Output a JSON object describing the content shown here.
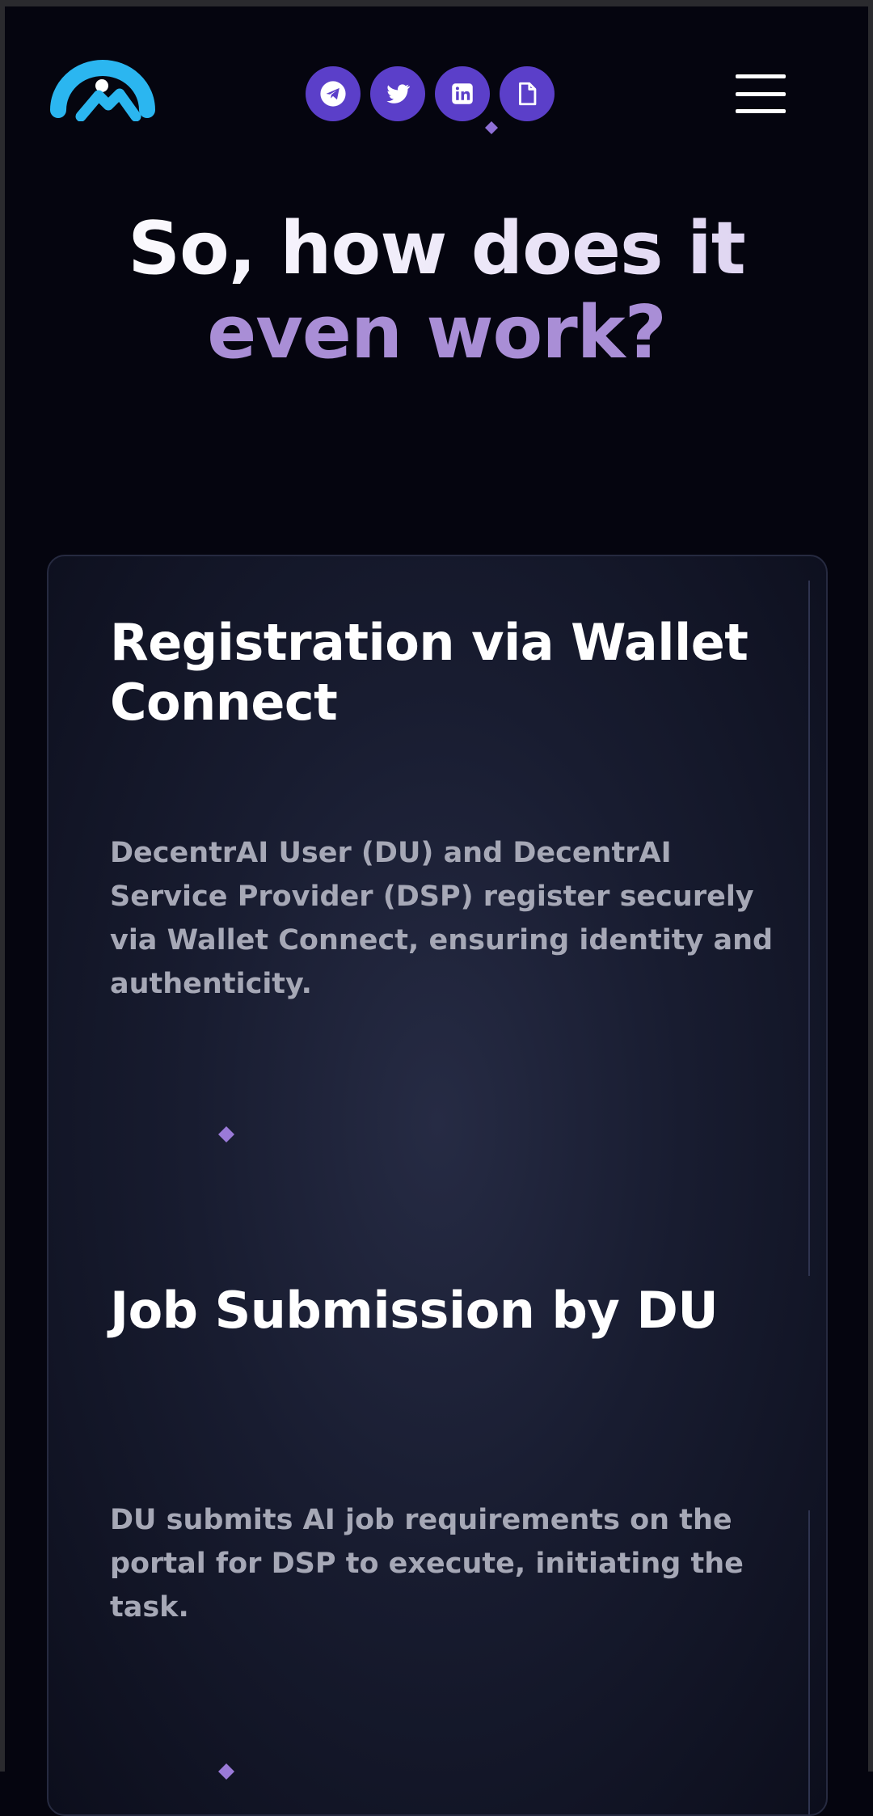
{
  "header": {
    "logo_name": "arch-logo",
    "socials": [
      {
        "name": "telegram",
        "icon": "telegram-icon"
      },
      {
        "name": "twitter",
        "icon": "twitter-icon"
      },
      {
        "name": "linkedin",
        "icon": "linkedin-icon"
      },
      {
        "name": "docs",
        "icon": "document-icon"
      }
    ],
    "menu_icon": "hamburger-menu-icon"
  },
  "hero": {
    "title_line1": "So, how does it",
    "title_line2": "even work?"
  },
  "steps": [
    {
      "title": "Registration via Wallet Connect",
      "description": "DecentrAI User (DU) and DecentrAI Service Provider (DSP)  register securely via Wallet Connect, ensuring identity and authenticity."
    },
    {
      "title": "Job Submission by DU",
      "description": "DU submits AI job requirements on the portal for DSP to execute, initiating the task."
    }
  ],
  "colors": {
    "background": "#05050f",
    "accent_purple": "#a98ed6",
    "social_button": "#5b3fc9",
    "logo_blue": "#2bb6f0",
    "text_muted": "#a6a8b6"
  }
}
